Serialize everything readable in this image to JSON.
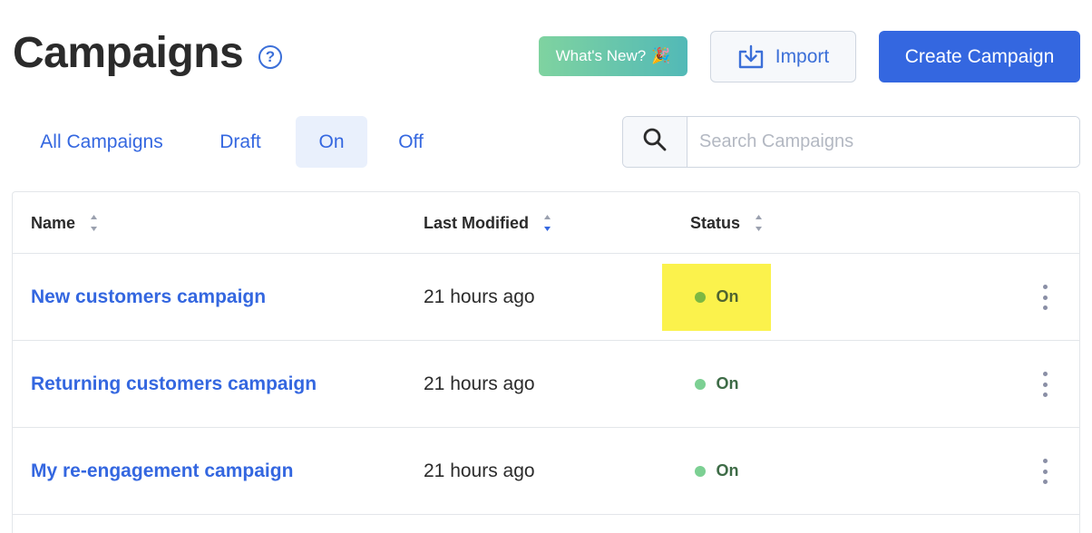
{
  "header": {
    "title": "Campaigns",
    "help_glyph": "?",
    "whats_new_label": "What's New?",
    "whats_new_emoji": "🎉",
    "import_label": "Import",
    "create_label": "Create Campaign"
  },
  "tabs": [
    {
      "label": "All Campaigns",
      "active": false
    },
    {
      "label": "Draft",
      "active": false
    },
    {
      "label": "On",
      "active": true
    },
    {
      "label": "Off",
      "active": false
    }
  ],
  "search": {
    "placeholder": "Search Campaigns",
    "value": ""
  },
  "table": {
    "columns": [
      "Name",
      "Last Modified",
      "Status"
    ],
    "rows": [
      {
        "name": "New customers campaign",
        "modified": "21 hours ago",
        "status": "On",
        "highlighted": true
      },
      {
        "name": "Returning customers campaign",
        "modified": "21 hours ago",
        "status": "On",
        "highlighted": false
      },
      {
        "name": "My re-engagement campaign",
        "modified": "21 hours ago",
        "status": "On",
        "highlighted": false
      }
    ]
  },
  "colors": {
    "accent": "#3467e0",
    "status_on": "#7cd093",
    "highlight": "#fbf24c",
    "whats_new_gradient_start": "#7fd3a0",
    "whats_new_gradient_end": "#52b9b7"
  },
  "icons": {
    "help": "question-circle-icon",
    "import": "download-tray-icon",
    "search": "magnifier-icon",
    "sort": "sort-arrows-icon",
    "row_menu": "kebab-menu-icon",
    "status": "status-dot-icon"
  }
}
